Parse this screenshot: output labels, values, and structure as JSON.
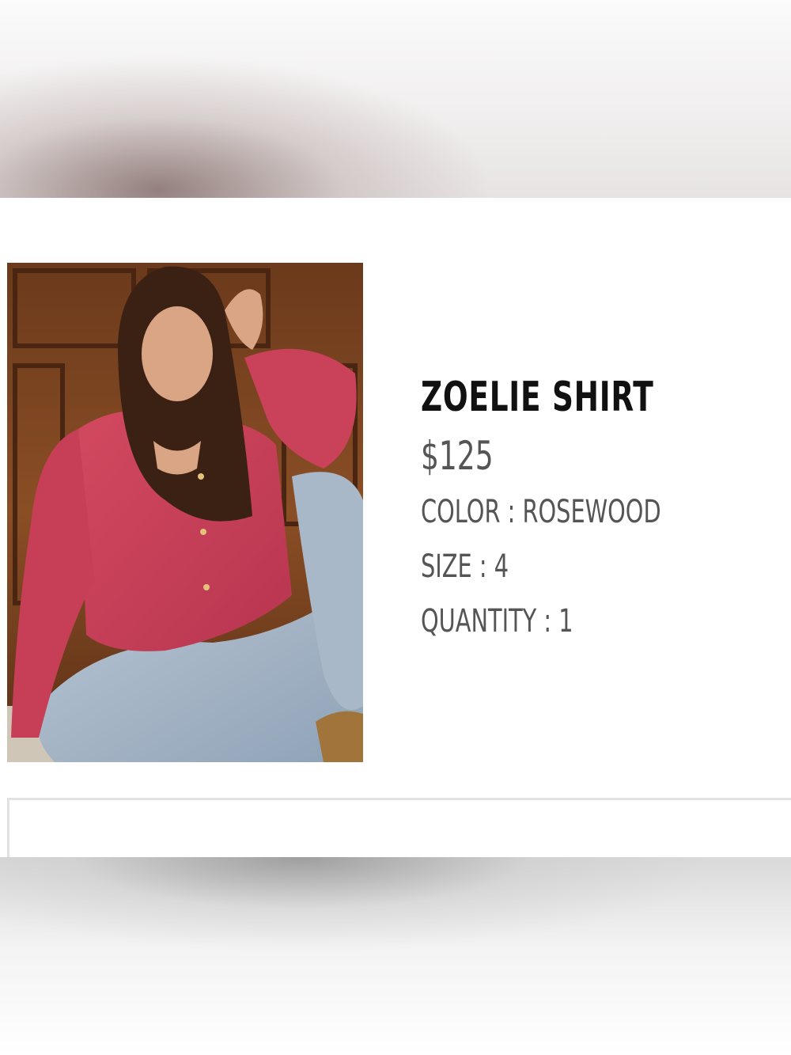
{
  "product": {
    "name": "ZOELIE SHIRT",
    "price": "$125",
    "color_line": "COLOR : ROSEWOOD",
    "size_line": "SIZE : 4",
    "quantity_line": "QUANTITY : 1"
  }
}
